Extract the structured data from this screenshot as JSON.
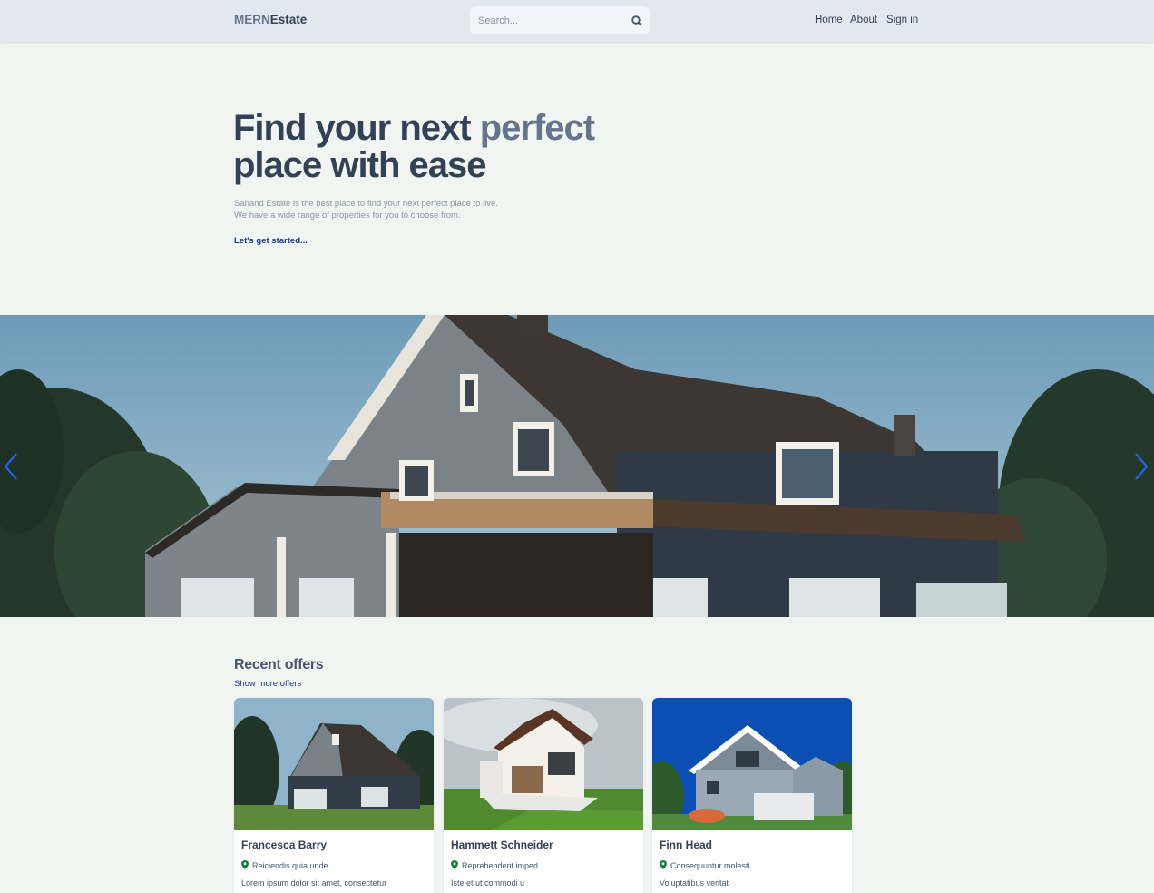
{
  "header": {
    "logo_part1": "MERN",
    "logo_part2": "Estate",
    "search_placeholder": "Search...",
    "nav": [
      "Home",
      "About",
      "Sign in"
    ]
  },
  "hero": {
    "title_part1": "Find your next ",
    "title_highlight": "perfect",
    "title_part2": "place with ease",
    "subtitle_line1": "Sahand Estate is the best place to find your next perfect place to live.",
    "subtitle_line2": "We have a wide range of properties for you to choose from.",
    "cta": "Let's get started..."
  },
  "offers": {
    "title": "Recent offers",
    "more_link": "Show more offers",
    "cards": [
      {
        "name": "Francesca Barry",
        "location": "Reiciendis quia unde",
        "description": "Lorem ipsum dolor sit amet, consectetur"
      },
      {
        "name": "Hammett Schneider",
        "location": "Reprehenderit imped",
        "description": "Iste et ut commodi u"
      },
      {
        "name": "Finn Head",
        "location": "Consequuntur molesti",
        "description": "Voluptatibus veritat"
      }
    ]
  },
  "colors": {
    "background": "#f1f5f1",
    "header": "#e2e8f0",
    "accent_link": "#1e3a8a",
    "slider_arrow": "#2563eb",
    "location_pin": "#15803d"
  },
  "icons": [
    "search-icon",
    "chevron-left-icon",
    "chevron-right-icon",
    "location-pin-icon"
  ]
}
